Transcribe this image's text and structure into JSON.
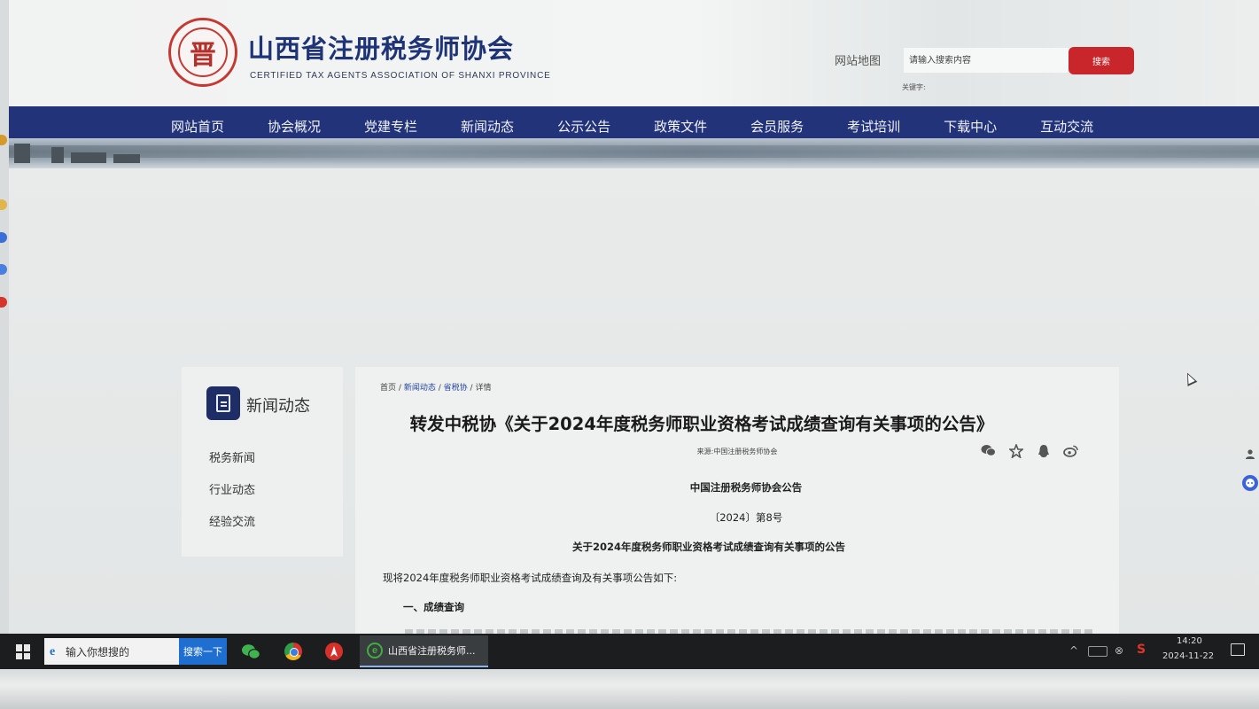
{
  "header": {
    "logo_char": "晋",
    "site_title": "山西省注册税务师协会",
    "site_subtitle": "CERTIFIED TAX AGENTS ASSOCIATION OF SHANXI PROVINCE",
    "sitemap_label": "网站地图",
    "search_placeholder": "请输入搜索内容",
    "search_button_label": "搜索",
    "keyword_label": "关键字:"
  },
  "nav": {
    "items": [
      "网站首页",
      "协会概况",
      "党建专栏",
      "新闻动态",
      "公示公告",
      "政策文件",
      "会员服务",
      "考试培训",
      "下载中心",
      "互动交流"
    ]
  },
  "sidebar": {
    "title": "新闻动态",
    "items": [
      "税务新闻",
      "行业动态",
      "经验交流"
    ]
  },
  "breadcrumb": {
    "home": "首页",
    "sep": "/",
    "news": "新闻动态",
    "province": "省税协",
    "detail": "详情"
  },
  "article": {
    "title": "转发中税协《关于2024年度税务师职业资格考试成绩查询有关事项的公告》",
    "source": "来源:中国注册税务师协会",
    "notice_org": "中国注册税务师协会公告",
    "notice_number": "〔2024〕第8号",
    "notice_title": "关于2024年度税务师职业资格考试成绩查询有关事项的公告",
    "intro": "现将2024年度税务师职业资格考试成绩查询及有关事项公告如下:",
    "section_heading": "一、成绩查询"
  },
  "share_icons": [
    "wechat-icon",
    "star-icon",
    "qq-icon",
    "weibo-icon"
  ],
  "taskbar": {
    "search_placeholder": "输入你想搜的",
    "search_button": "搜索一下",
    "window_title": "山西省注册税务师...",
    "time": "14:20",
    "date": "2024-11-22"
  },
  "colors": {
    "nav_bg": "#23337a",
    "title_blue": "#1f3476",
    "search_red": "#c8262b",
    "seal_red": "#c43a33"
  }
}
